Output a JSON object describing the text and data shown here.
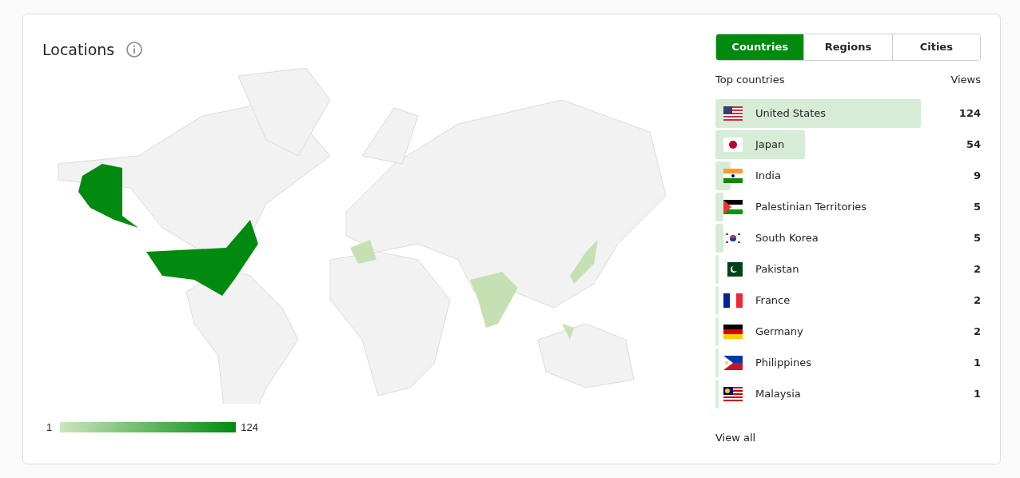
{
  "title": "Locations",
  "legend": {
    "min": "1",
    "max": "124"
  },
  "tabs": [
    {
      "label": "Countries",
      "selected": true
    },
    {
      "label": "Regions",
      "selected": false
    },
    {
      "label": "Cities",
      "selected": false
    }
  ],
  "list_header": {
    "label": "Top countries",
    "value": "Views"
  },
  "countries": [
    {
      "name": "United States",
      "views": "124"
    },
    {
      "name": "Japan",
      "views": "54"
    },
    {
      "name": "India",
      "views": "9"
    },
    {
      "name": "Palestinian Territories",
      "views": "5"
    },
    {
      "name": "South Korea",
      "views": "5"
    },
    {
      "name": "Pakistan",
      "views": "2"
    },
    {
      "name": "France",
      "views": "2"
    },
    {
      "name": "Germany",
      "views": "2"
    },
    {
      "name": "Philippines",
      "views": "1"
    },
    {
      "name": "Malaysia",
      "views": "1"
    }
  ],
  "view_all": "View all"
}
